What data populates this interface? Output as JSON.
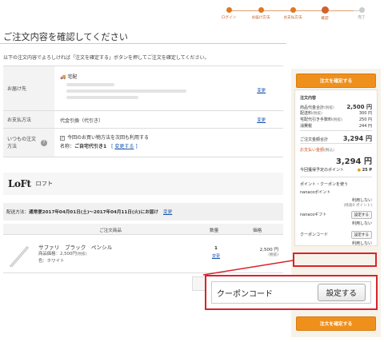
{
  "steps": [
    {
      "label": "ログイン",
      "state": "done"
    },
    {
      "label": "お届け方法",
      "state": "done"
    },
    {
      "label": "お支払方法",
      "state": "done"
    },
    {
      "label": "確認",
      "state": "current"
    },
    {
      "label": "完了",
      "state": "todo"
    }
  ],
  "page_title": "ご注文内容を確認してください",
  "lead_text": "以下の注文内容でよろしければ「注文を確定する」ボタンを押してご注文を確定してください。",
  "delivery": {
    "label": "お届け先",
    "type": "宅配",
    "change": "変更"
  },
  "payment": {
    "label": "お支払方法",
    "value": "代金引換（代引き）",
    "change": "変更"
  },
  "usual": {
    "label": "いつもの注文方法",
    "help_icon": "question-icon",
    "checkbox_text": "今回のお買い物方法を次回も利用する",
    "name_label": "名称：",
    "name_value": "ご自宅代引き1",
    "bracket_open": "[",
    "change_link": "変更する",
    "bracket_close": "]"
  },
  "shop": {
    "logo": "LoFt",
    "name": "ロフト"
  },
  "shipping": {
    "label": "配送方法：",
    "value": "通常便2017年04月01日(土)〜2017年04月11日(火)にお届け",
    "change": "変更"
  },
  "items_head": {
    "product": "ご注文商品",
    "qty": "数量",
    "price": "価格"
  },
  "item": {
    "name": "サファリ　ブラック　ペンシル",
    "unit_price_label": "商品価格：2,500円",
    "unit_price_note": "(税抜)",
    "color_label": "色：ホワイト",
    "qty": "1",
    "qty_change": "変更",
    "price": "2,500 円",
    "price_note": "(税抜)"
  },
  "sidebar": {
    "confirm_top": "注文を確定する",
    "confirm_bottom": "注文を確定する",
    "summary_title": "注文内容",
    "subtotal_label": "商品代金合計",
    "subtotal_note": "(税抜)",
    "subtotal_value": "2,500 円",
    "shipping_label": "配送料",
    "shipping_note": "(税抜)",
    "shipping_value": "300 円",
    "cod_label": "宅配代引き手数料",
    "cod_note": "(税抜)",
    "cod_value": "250 円",
    "tax_label": "消費税",
    "tax_value": "244 円",
    "total_label": "ご注文金額合計",
    "total_value": "3,294 円",
    "pay_label": "お支払い金額",
    "pay_note": "(税込)",
    "pay_value": "3,294 円",
    "points_label": "今回獲得予定のポイント",
    "points_value": "25 P",
    "coupon_title": "ポイント・クーポンを使う",
    "nanaco_point": "nanacoポイント",
    "nanaco_point_status": "利用しない",
    "nanaco_point_note": "(残高0 ポイント)",
    "nanaco_gift": "nanacoギフト",
    "nanaco_gift_btn": "設定する",
    "nanaco_gift_status": "利用しない",
    "coupon_code": "クーポンコード",
    "coupon_btn": "設定する",
    "coupon_status": "利用しない"
  },
  "callout": {
    "label": "クーポンコード",
    "button": "設定する"
  },
  "colors": {
    "accent": "#f0901c",
    "highlight": "#d9232a",
    "price": "#d2501f",
    "link": "#1a56b0"
  }
}
